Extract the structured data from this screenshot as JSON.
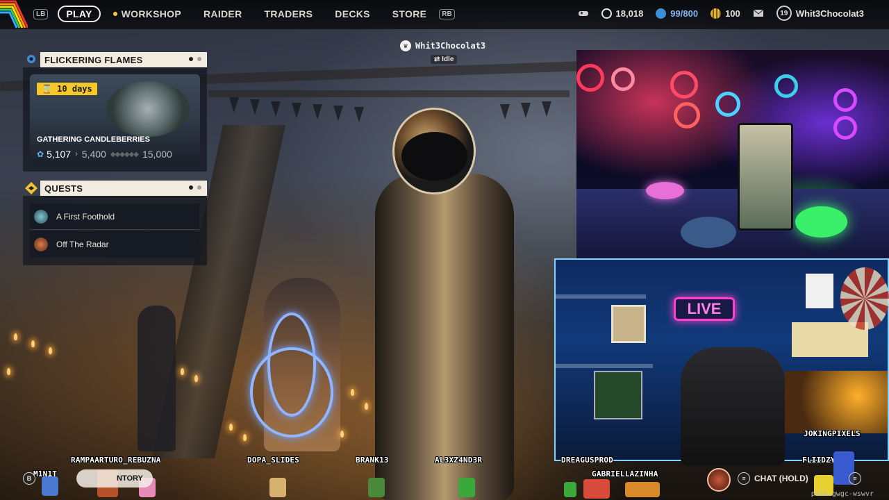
{
  "topbar": {
    "lb": "LB",
    "rb": "RB",
    "nav": [
      {
        "label": "PLAY",
        "active": true
      },
      {
        "label": "WORKSHOP"
      },
      {
        "label": "RAIDER"
      },
      {
        "label": "TRADERS"
      },
      {
        "label": "DECKS"
      },
      {
        "label": "STORE"
      }
    ],
    "coins": "18,018",
    "slots": "99/800",
    "tokens": "100",
    "level": "19",
    "username": "Whit3Chocolat3"
  },
  "event": {
    "title": "FLICKERING FLAMES",
    "timer": "10 days",
    "name": "GATHERING CANDLEBERRIES",
    "current": "5,107",
    "next": "5,400",
    "max": "15,000"
  },
  "quests": {
    "title": "QUESTS",
    "items": [
      {
        "label": "A First Foothold"
      },
      {
        "label": "Off The Radar"
      }
    ]
  },
  "player": {
    "name": "Whit3Chocolat3",
    "status": "Idle"
  },
  "overlay": {
    "live_sign": "LIVE"
  },
  "viewers": {
    "v1": "RAMPAARTURO_REBUZNA",
    "v2": "DOPA_SLIDES",
    "v3": "BRANK13",
    "v4": "AL3XZ4ND3R",
    "v5": "DREAGUSPROD",
    "v6": "GABRIELLAZINHA",
    "v7": "FLIIDZY",
    "v8": "JOKINGPIXELS",
    "v9": "M1N1T"
  },
  "bottom": {
    "b_key": "B",
    "inventory_label": "NTORY",
    "chat_label": "CHAT (HOLD)",
    "code": "p318…gwgc-wswvr"
  }
}
